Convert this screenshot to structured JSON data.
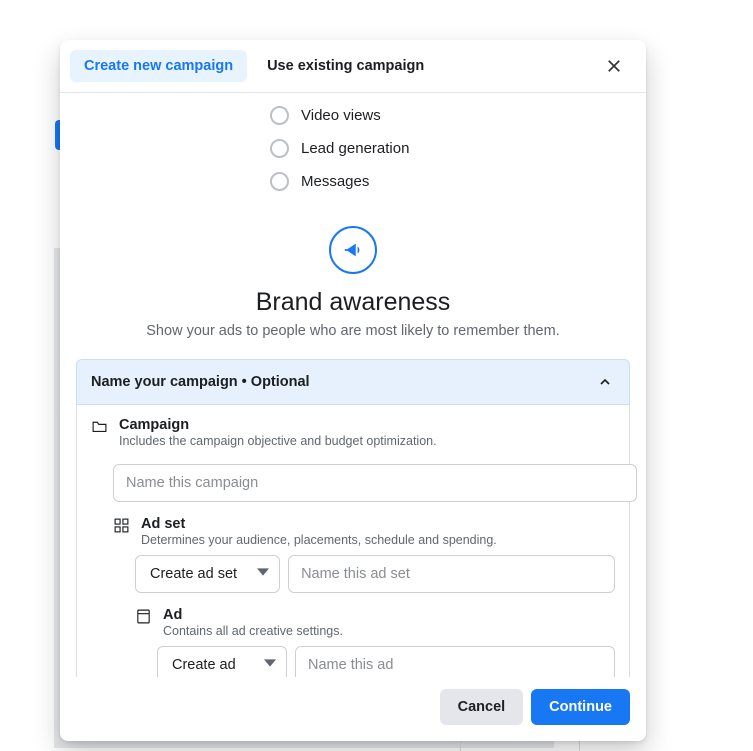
{
  "header": {
    "tab_create": "Create new campaign",
    "tab_existing": "Use existing campaign"
  },
  "objectives": {
    "video_views": "Video views",
    "lead_generation": "Lead generation",
    "messages": "Messages"
  },
  "hero": {
    "title": "Brand awareness",
    "desc": "Show your ads to people who are most likely to remember them."
  },
  "section": {
    "title": "Name your campaign • Optional"
  },
  "campaign": {
    "label": "Campaign",
    "desc": "Includes the campaign objective and budget optimization.",
    "placeholder": "Name this campaign"
  },
  "adset": {
    "label": "Ad set",
    "desc": "Determines your audience, placements, schedule and spending.",
    "dropdown": "Create ad set",
    "placeholder": "Name this ad set"
  },
  "ad": {
    "label": "Ad",
    "desc": "Contains all ad creative settings.",
    "dropdown": "Create ad",
    "placeholder": "Name this ad"
  },
  "footer": {
    "cancel": "Cancel",
    "continue": "Continue"
  }
}
